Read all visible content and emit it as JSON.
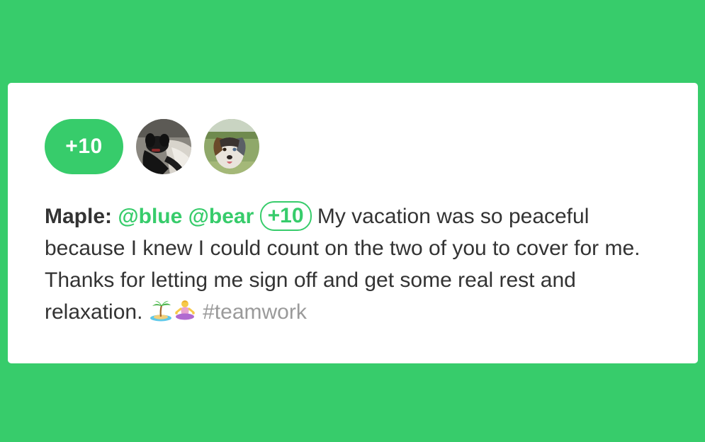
{
  "colors": {
    "brand_green": "#37cc6b",
    "card_background": "#ffffff",
    "text": "#333333",
    "hashtag": "#9a9a9a"
  },
  "recognition": {
    "points_badge": "+10",
    "recipients": [
      {
        "avatar_icon": "dog-avatar-black-labrador"
      },
      {
        "avatar_icon": "dog-avatar-australian-shepherd"
      }
    ],
    "message": {
      "author": "Maple:",
      "mentions": [
        "@blue",
        "@bear"
      ],
      "points_inline": "+10",
      "text_before_emoji": "My vacation was so peaceful because I knew I could count on the two of you to cover for me. Thanks for letting me sign off and get some real rest and relaxation.",
      "emojis": [
        "desert-island-emoji",
        "person-in-lotus-position-emoji"
      ],
      "hashtag": "#teamwork"
    }
  }
}
